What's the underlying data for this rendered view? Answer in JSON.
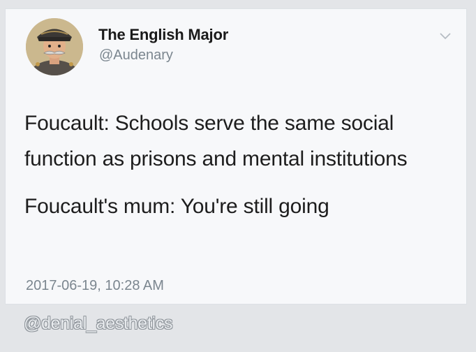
{
  "tweet": {
    "display_name": "The English Major",
    "handle": "@Audenary",
    "paragraphs": [
      "Foucault: Schools serve the same social function as prisons and mental institutions",
      "Foucault's mum: You're still going"
    ],
    "timestamp": "2017-06-19, 10:28 AM",
    "avatar_icon": "cartoon-officer-portrait",
    "menu_icon": "chevron-down-icon"
  },
  "watermark": "@denial_aesthetics",
  "colors": {
    "background": "#e3e5e8",
    "card": "#f7f8fa",
    "text": "#1d1d1d",
    "secondary_text": "#7b868f"
  }
}
